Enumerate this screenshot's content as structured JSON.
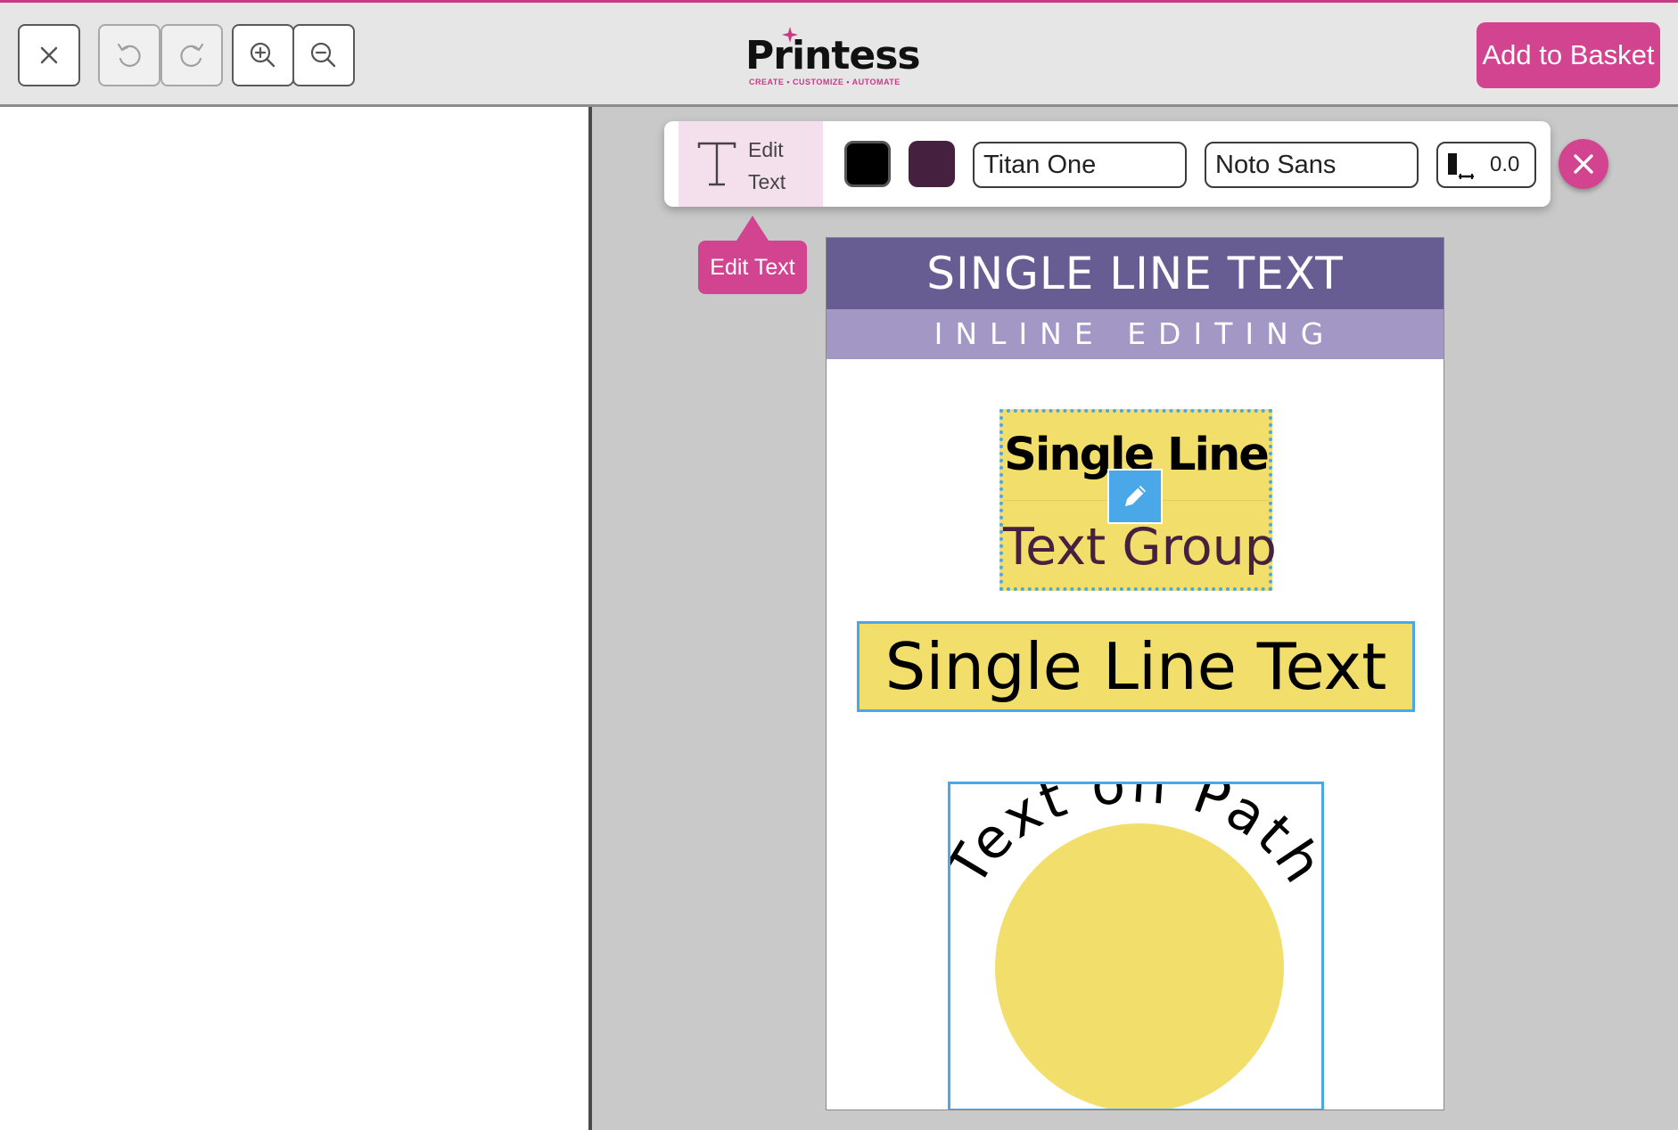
{
  "colors": {
    "accent": "#d2448f",
    "selection": "#4aa8e8",
    "header_purple": "#675d92",
    "subheader_lavender": "#a398c5",
    "yellow": "#f2de6b",
    "canvas_gray": "#c9c9c9"
  },
  "topbar": {
    "buttons": [
      {
        "name": "close-icon",
        "enabled": true
      },
      {
        "name": "undo-icon",
        "enabled": false
      },
      {
        "name": "redo-icon",
        "enabled": false
      },
      {
        "name": "zoom-in-icon",
        "enabled": true
      },
      {
        "name": "zoom-out-icon",
        "enabled": true
      }
    ],
    "logo": {
      "word": "Printess",
      "tagline": "CREATE • CUSTOMIZE • AUTOMATE"
    },
    "basket_label": "Add to Basket"
  },
  "text_toolbar": {
    "edit_text_icon": "text-t-icon",
    "edit_text_label_line1": "Edit",
    "edit_text_label_line2": "Text",
    "color_1": "#000000",
    "color_2": "#46213f",
    "font_1": "Titan One",
    "font_2": "Noto Sans",
    "spacing_icon": "line-spacing-icon",
    "spacing_value": "0.0",
    "close_icon": "close-circle-icon"
  },
  "tooltip": {
    "label": "Edit Text"
  },
  "document": {
    "header": "SINGLE LINE TEXT",
    "subheader": "INLINE EDITING",
    "text_group": {
      "line1": "Single Line",
      "line2": "Text Group",
      "line2_color": "#46213f"
    },
    "single_line": "Single Line Text",
    "path_text": "Text on Path"
  }
}
